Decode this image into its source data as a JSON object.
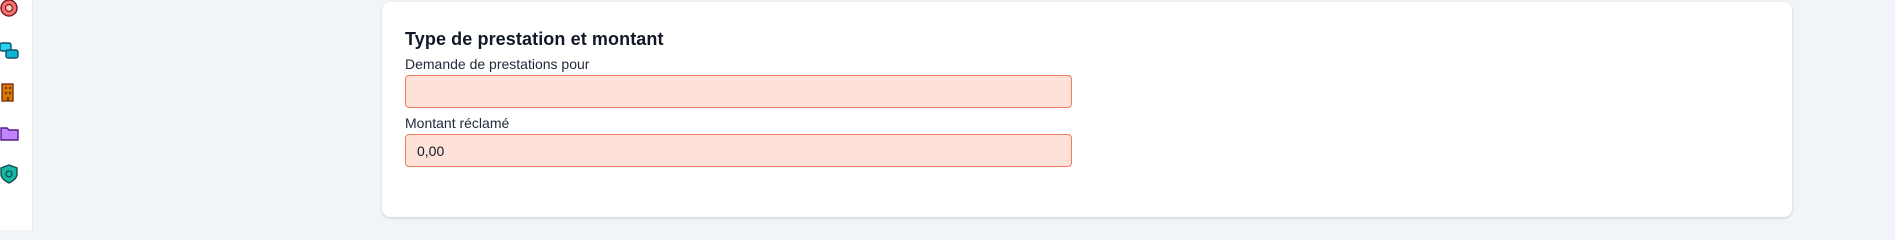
{
  "sidebar": {
    "icons": [
      {
        "name": "badge-icon",
        "color": "#ef4444"
      },
      {
        "name": "coins-stack-icon",
        "color": "#0891b2"
      },
      {
        "name": "building-icon",
        "color": "#b45309"
      },
      {
        "name": "folder-icon",
        "color": "#a855f7"
      },
      {
        "name": "shield-check-icon",
        "color": "#0d9488"
      }
    ]
  },
  "section": {
    "title": "Type de prestation et montant",
    "fields": [
      {
        "label": "Demande de prestations pour",
        "value": "",
        "placeholder": ""
      },
      {
        "label": "Montant réclamé",
        "value": "0,00",
        "placeholder": ""
      }
    ]
  },
  "colors": {
    "background": "#f1f5f9",
    "input_background": "#fee2d9",
    "input_border": "#ea7f5e"
  }
}
